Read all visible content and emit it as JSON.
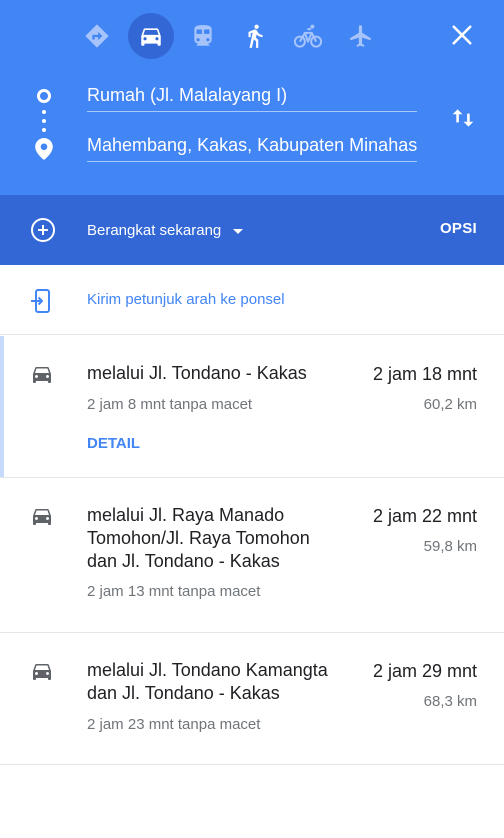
{
  "colors": {
    "header": "#4285f4",
    "depart_bar": "#3367d6",
    "link": "#4285f4",
    "secondary_text": "#70757a",
    "selected_route_marker": "#c6dafc"
  },
  "travel_modes": [
    {
      "icon": "directions-best-icon",
      "selected": false
    },
    {
      "icon": "car-icon",
      "selected": true
    },
    {
      "icon": "transit-icon",
      "selected": false
    },
    {
      "icon": "walk-icon",
      "selected": false
    },
    {
      "icon": "bicycle-icon",
      "selected": false
    },
    {
      "icon": "flight-icon",
      "selected": false
    }
  ],
  "search": {
    "origin": "Rumah (Jl. Malalayang I)",
    "destination": "Mahembang, Kakas, Kabupaten Minahasa"
  },
  "depart": {
    "label": "Berangkat sekarang",
    "options_label": "OPSI"
  },
  "send_to_phone": {
    "label": "Kirim petunjuk arah ke ponsel"
  },
  "routes": [
    {
      "name": "melalui Jl. Tondano - Kakas",
      "duration": "2 jam 18 mnt",
      "distance": "60,2 km",
      "traffic_note": "2 jam 8 mnt tanpa macet",
      "detail_label": "DETAIL",
      "selected": true
    },
    {
      "name": "melalui Jl. Raya Manado Tomohon/Jl. Raya Tomohon dan Jl. Tondano - Kakas",
      "duration": "2 jam 22 mnt",
      "distance": "59,8 km",
      "traffic_note": "2 jam 13 mnt tanpa macet",
      "selected": false
    },
    {
      "name": "melalui Jl. Tondano Kamangta dan Jl. Tondano - Kakas",
      "duration": "2 jam 29 mnt",
      "distance": "68,3 km",
      "traffic_note": "2 jam 23 mnt tanpa macet",
      "selected": false
    }
  ]
}
